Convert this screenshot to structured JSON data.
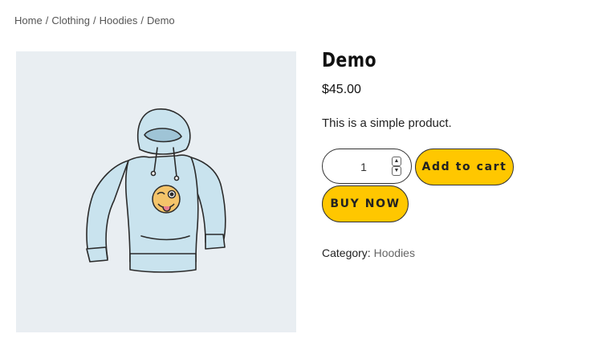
{
  "breadcrumb": {
    "items": [
      "Home",
      "Clothing",
      "Hoodies",
      "Demo"
    ],
    "separator": "/"
  },
  "product": {
    "title": "Demo",
    "price": "$45.00",
    "description": "This is a simple product.",
    "quantity": "1",
    "add_to_cart_label": "Add to cart",
    "buy_now_label": "BUY NOW",
    "category_label": "Category:",
    "category_value": "Hoodies",
    "image_icon": "hoodie-with-winking-emoji"
  },
  "colors": {
    "accent": "#ffc700",
    "image_background": "#e9eef2",
    "hoodie": "#c9e3ee"
  }
}
